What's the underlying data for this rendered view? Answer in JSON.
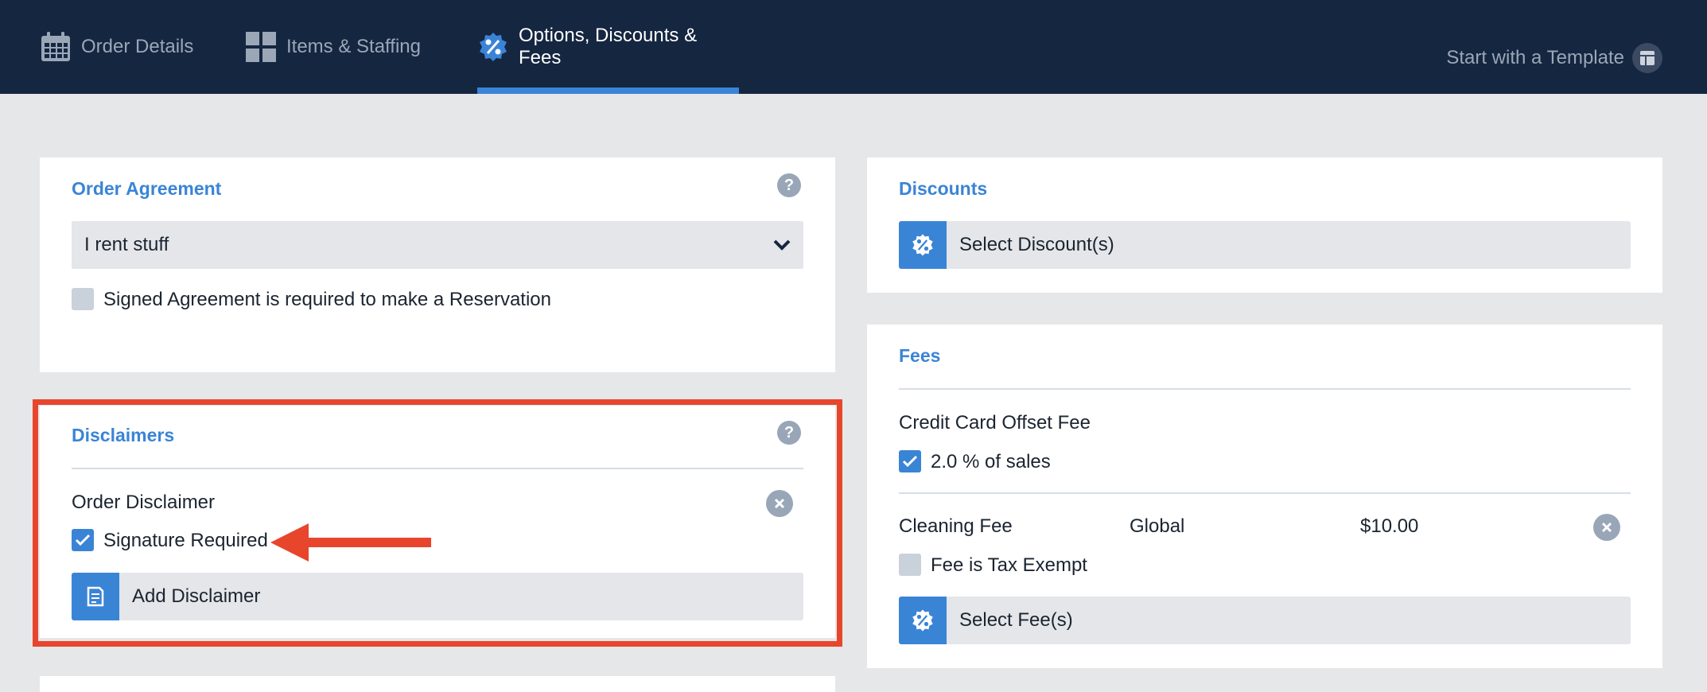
{
  "nav": {
    "tabs": [
      {
        "label": "Order Details",
        "icon": "calendar-icon"
      },
      {
        "label": "Items & Staffing",
        "icon": "grid-icon"
      },
      {
        "label": "Options, Discounts & Fees",
        "icon": "percent-badge-icon",
        "active": true
      }
    ],
    "template_link": "Start with a Template"
  },
  "order_agreement": {
    "title": "Order Agreement",
    "selected": "I rent stuff",
    "checkbox_label": "Signed Agreement is required to make a Reservation",
    "checkbox_checked": false
  },
  "disclaimers": {
    "title": "Disclaimers",
    "item_name": "Order Disclaimer",
    "signature_label": "Signature Required",
    "signature_checked": true,
    "add_label": "Add Disclaimer"
  },
  "discounts": {
    "title": "Discounts",
    "select_label": "Select Discount(s)"
  },
  "fees": {
    "title": "Fees",
    "credit_card": {
      "name": "Credit Card Offset Fee",
      "option_label": "2.0 % of sales",
      "checked": true
    },
    "cleaning": {
      "name": "Cleaning Fee",
      "scope": "Global",
      "amount": "$10.00",
      "tax_exempt_label": "Fee is Tax Exempt",
      "tax_exempt_checked": false
    },
    "select_label": "Select Fee(s)"
  },
  "colors": {
    "nav_bg": "#152641",
    "accent": "#3a84d6",
    "highlight": "#e8452d"
  }
}
